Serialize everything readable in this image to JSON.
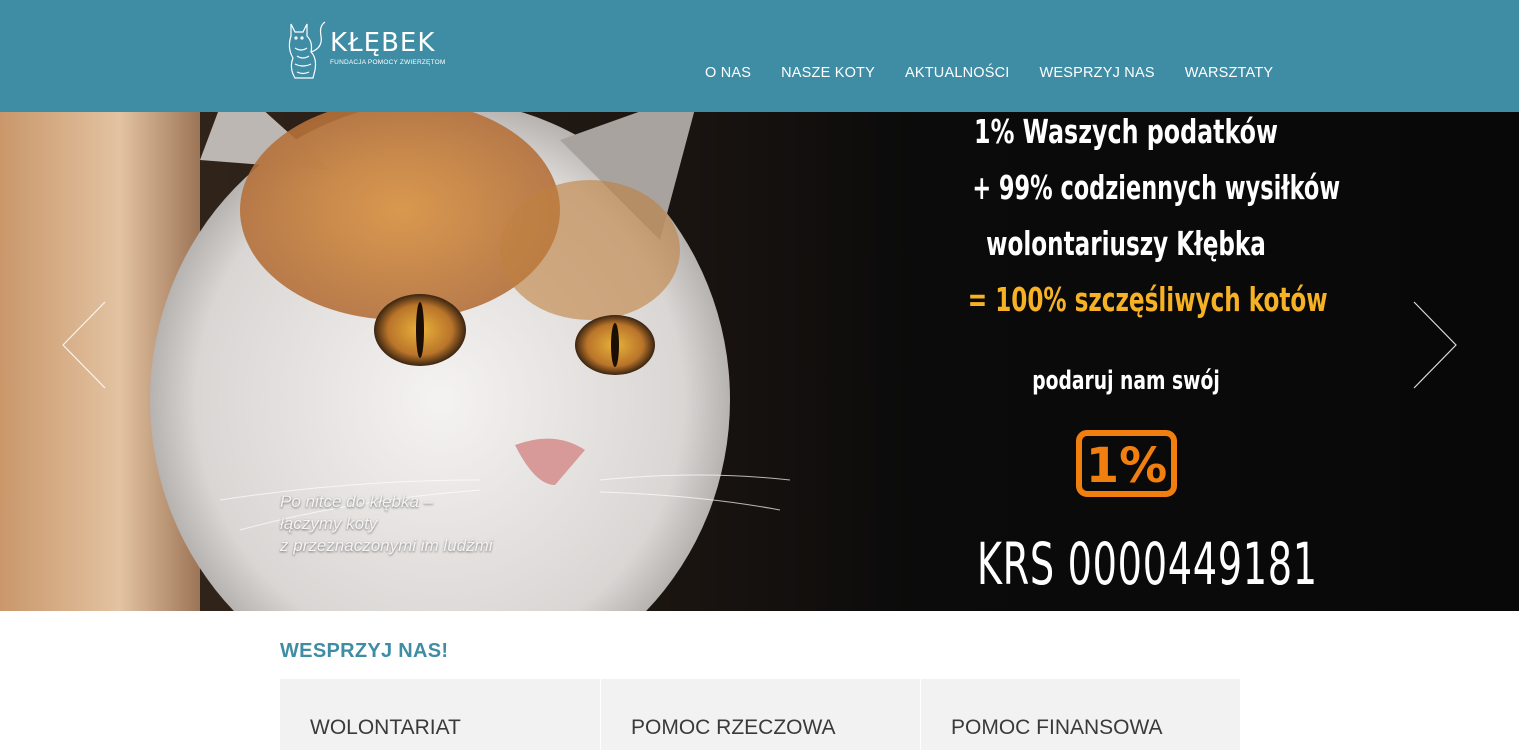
{
  "header": {
    "logo_title": "KŁĘBEK",
    "logo_subtitle": "FUNDACJA POMOCY ZWIERZĘTOM",
    "nav": [
      "O NAS",
      "NASZE KOTY",
      "AKTUALNOŚCI",
      "WESPRZYJ NAS",
      "WARSZTATY"
    ],
    "bg_color": "#3f8da5"
  },
  "hero": {
    "caption_lines": [
      "Po nitce do kłębka –",
      "łączymy koty",
      "z przeznaczonymi im ludźmi"
    ],
    "promo": {
      "line1": "1% Waszych podatków",
      "line2": "+ 99% codziennych wysiłków",
      "line3": "wolontariuszy Kłębka",
      "line4": "= 100% szczęśliwych kotów",
      "line5": "podaruj nam swój",
      "badge": "1%",
      "krs": "KRS 0000449181",
      "accent_color": "#f6b224",
      "badge_color": "#f07f0f"
    },
    "prev_icon": "chevron-left-icon",
    "next_icon": "chevron-right-icon"
  },
  "support": {
    "title": "WESPRZYJ NAS!",
    "cards": [
      "WOLONTARIAT",
      "POMOC RZECZOWA",
      "POMOC FINANSOWA"
    ]
  }
}
